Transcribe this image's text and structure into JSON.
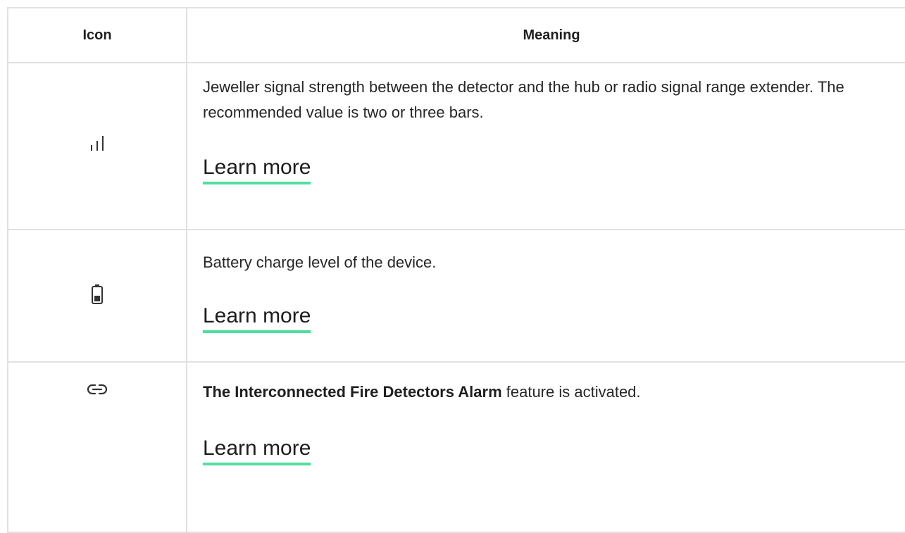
{
  "table": {
    "headers": {
      "icon": "Icon",
      "meaning": "Meaning"
    },
    "rows": [
      {
        "icon": "signal-strength-icon",
        "description": "Jeweller signal strength between the detector and the hub or radio signal range extender. The recommended value is two or three bars.",
        "link_label": "Learn more"
      },
      {
        "icon": "battery-icon",
        "description": "Battery charge level of the device.",
        "link_label": "Learn more"
      },
      {
        "icon": "link-icon",
        "description_bold": "The Interconnected Fire Detectors Alarm",
        "description_rest": " feature is activated.",
        "link_label": "Learn more"
      }
    ]
  },
  "colors": {
    "link_underline": "#52de9f",
    "border": "#e1e1e1",
    "text": "#262626"
  }
}
